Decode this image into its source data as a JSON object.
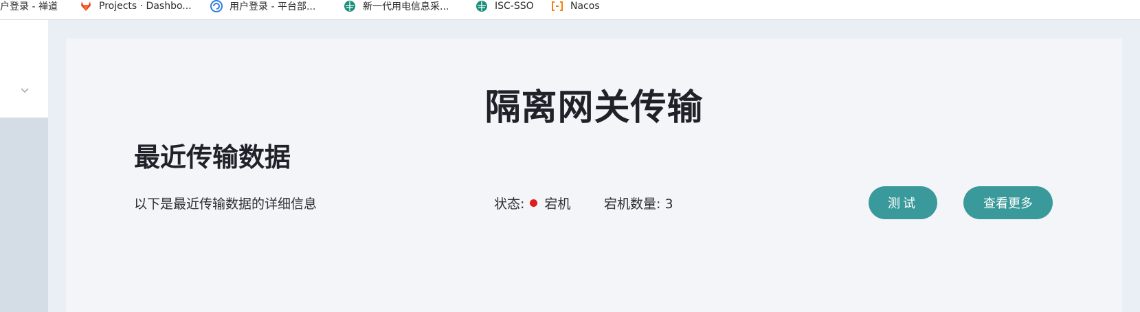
{
  "bookmarks": [
    {
      "label": "用户登录 - 禅道",
      "icon": "zentao-icon"
    },
    {
      "label": "Projects · Dashbo...",
      "icon": "gitlab-icon",
      "color": "#e24329"
    },
    {
      "label": "用户登录 - 平台部...",
      "icon": "globe-swirl-icon",
      "color": "#2d7be0"
    },
    {
      "label": "新一代用电信息采...",
      "icon": "sgcc-icon",
      "color": "#1a8f7a"
    },
    {
      "label": "ISC-SSO",
      "icon": "sgcc-icon",
      "color": "#1a8f7a"
    },
    {
      "label": "Nacos",
      "icon": "nacos-icon",
      "color": "#f2810d"
    }
  ],
  "sidebar": {
    "toggle_icon": "chevron-down-icon"
  },
  "main": {
    "page_title": "隔离网关传输",
    "section_title": "最近传输数据",
    "description": "以下是最近传输数据的详细信息",
    "status_label": "状态:",
    "status_value": "宕机",
    "status_color": "#e01c1c",
    "down_count_label": "宕机数量: 3",
    "test_button": "测试",
    "more_button": "查看更多",
    "accent_color": "#3a9a9b"
  }
}
